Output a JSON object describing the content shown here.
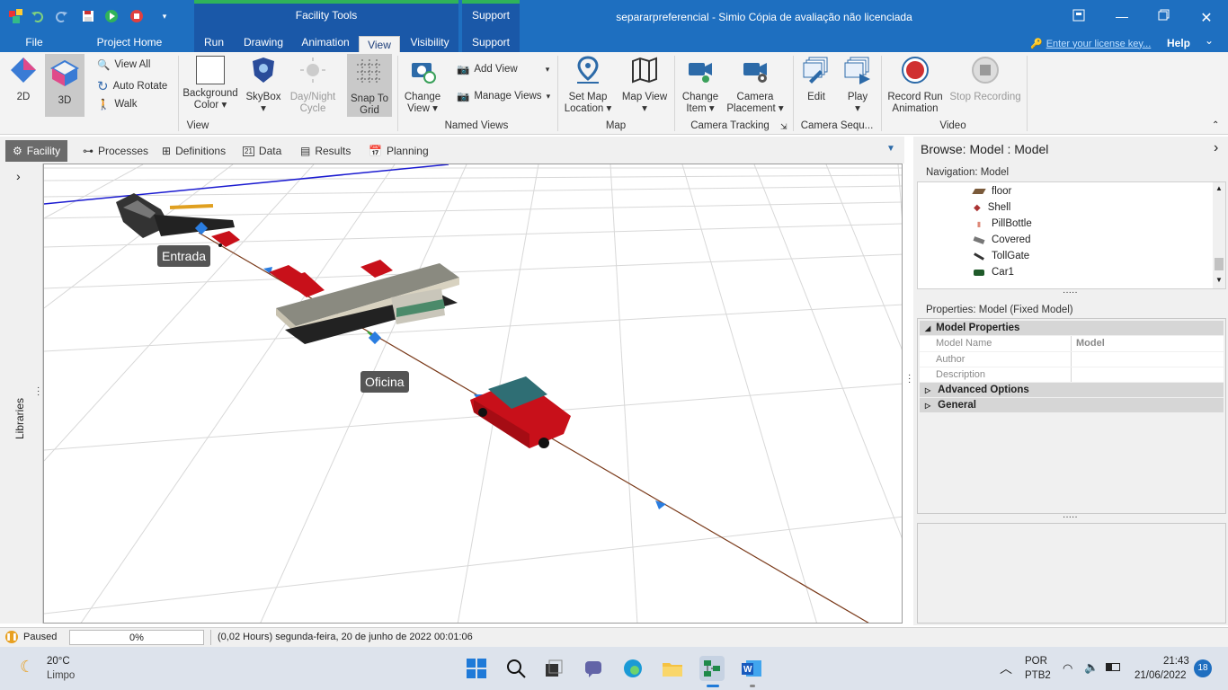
{
  "window": {
    "title": "separarpreferencial - Simio Cópia de avaliação não licenciada",
    "context_facility": "Facility Tools",
    "context_support": "Support",
    "license_link": "Enter your license key...",
    "help": "Help"
  },
  "tabs": {
    "file": "File",
    "project_home": "Project Home",
    "run": "Run",
    "drawing": "Drawing",
    "animation": "Animation",
    "view": "View",
    "visibility": "Visibility",
    "support": "Support"
  },
  "ribbon": {
    "btn_2d": "2D",
    "btn_3d": "3D",
    "view_all": "View All",
    "auto_rotate": "Auto Rotate",
    "walk": "Walk",
    "background_color_1": "Background",
    "background_color_2": "Color",
    "skybox": "SkyBox",
    "day_night_1": "Day/Night",
    "day_night_2": "Cycle",
    "snap_1": "Snap To",
    "snap_2": "Grid",
    "group_view": "View",
    "change_view_1": "Change",
    "change_view_2": "View",
    "add_view": "Add View",
    "manage_views": "Manage Views",
    "group_named_views": "Named Views",
    "set_map_1": "Set Map",
    "set_map_2": "Location",
    "map_view": "Map View",
    "group_map": "Map",
    "change_item_1": "Change",
    "change_item_2": "Item",
    "camera_placement_1": "Camera",
    "camera_placement_2": "Placement",
    "group_camera_tracking": "Camera Tracking",
    "edit": "Edit",
    "play": "Play",
    "group_camera_seq": "Camera Sequ...",
    "record_1": "Record Run",
    "record_2": "Animation",
    "stop_recording": "Stop Recording",
    "group_video": "Video"
  },
  "doc_tabs": {
    "facility": "Facility",
    "processes": "Processes",
    "definitions": "Definitions",
    "data": "Data",
    "results": "Results",
    "planning": "Planning"
  },
  "viewport": {
    "label_entrada": "Entrada",
    "label_oficina": "Oficina",
    "libraries": "Libraries"
  },
  "browse": {
    "title": "Browse: Model : Model",
    "nav_header": "Navigation: Model",
    "nav_items": [
      "floor",
      "Shell",
      "PillBottle",
      "Covered",
      "TollGate",
      "Car1"
    ],
    "props_header": "Properties: Model (Fixed Model)",
    "model_properties": "Model Properties",
    "model_name_label": "Model Name",
    "model_name_value": "Model",
    "author_label": "Author",
    "description_label": "Description",
    "advanced_options": "Advanced Options",
    "general": "General"
  },
  "status": {
    "state": "Paused",
    "progress": "0%",
    "progress_value": 0,
    "time": "(0,02 Hours) segunda-feira, 20 de junho de 2022 00:01:06"
  },
  "taskbar": {
    "temp": "20°C",
    "weather": "Limpo",
    "lang1": "POR",
    "lang2": "PTB2",
    "time": "21:43",
    "date": "21/06/2022",
    "notifications": "18"
  },
  "colors": {
    "titlebar": "#1e6fc0",
    "accent_green": "#2fb35a",
    "car_red": "#c8101a"
  }
}
